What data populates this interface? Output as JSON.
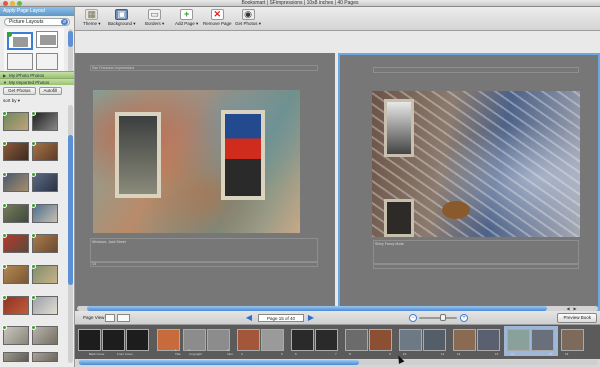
{
  "window": {
    "title": "Booksmart  |  SFimpressions  |  10x8 inches  |  40 Pages"
  },
  "left_panel": {
    "header": "Apply Page Layout",
    "layout_select": "Picture Layouts",
    "section_iphoto": "My iPhoto Photos",
    "section_imported": "My Imported Photos",
    "get_photos": "Get Photos",
    "autofill": "Autofill",
    "sort_by": "sort by"
  },
  "toolbar": {
    "theme": "Theme ▾",
    "background": "Background ▾",
    "borders": "Borders ▾",
    "add_page": "Add Page ▾",
    "remove_page": "Remove Page",
    "get_photos": "Get Photos ▾"
  },
  "spread": {
    "left_header": "San Francisco Impressions",
    "left_caption": "Windows, Jack Street",
    "left_page_no": "14",
    "right_caption": "Shiny Fancy Mode",
    "right_page_no": "15"
  },
  "navbar": {
    "page_view": "Page View",
    "page_indicator": "Page 15 of 40",
    "preview_book": "Preview Book"
  },
  "filmstrip": {
    "labels": [
      "Back Cover",
      "Front Cover",
      "1",
      "Title",
      "2",
      "Copyright",
      "3",
      "Intro",
      "4",
      "5",
      "6",
      "7",
      "8",
      "9",
      "10",
      "11",
      "12",
      "13",
      "14",
      "15",
      "16"
    ]
  },
  "colors": {
    "accent": "#4a8ad7",
    "selection": "#67a9e6",
    "section_green": "#9ac271",
    "check_green": "#3a9d2f"
  }
}
